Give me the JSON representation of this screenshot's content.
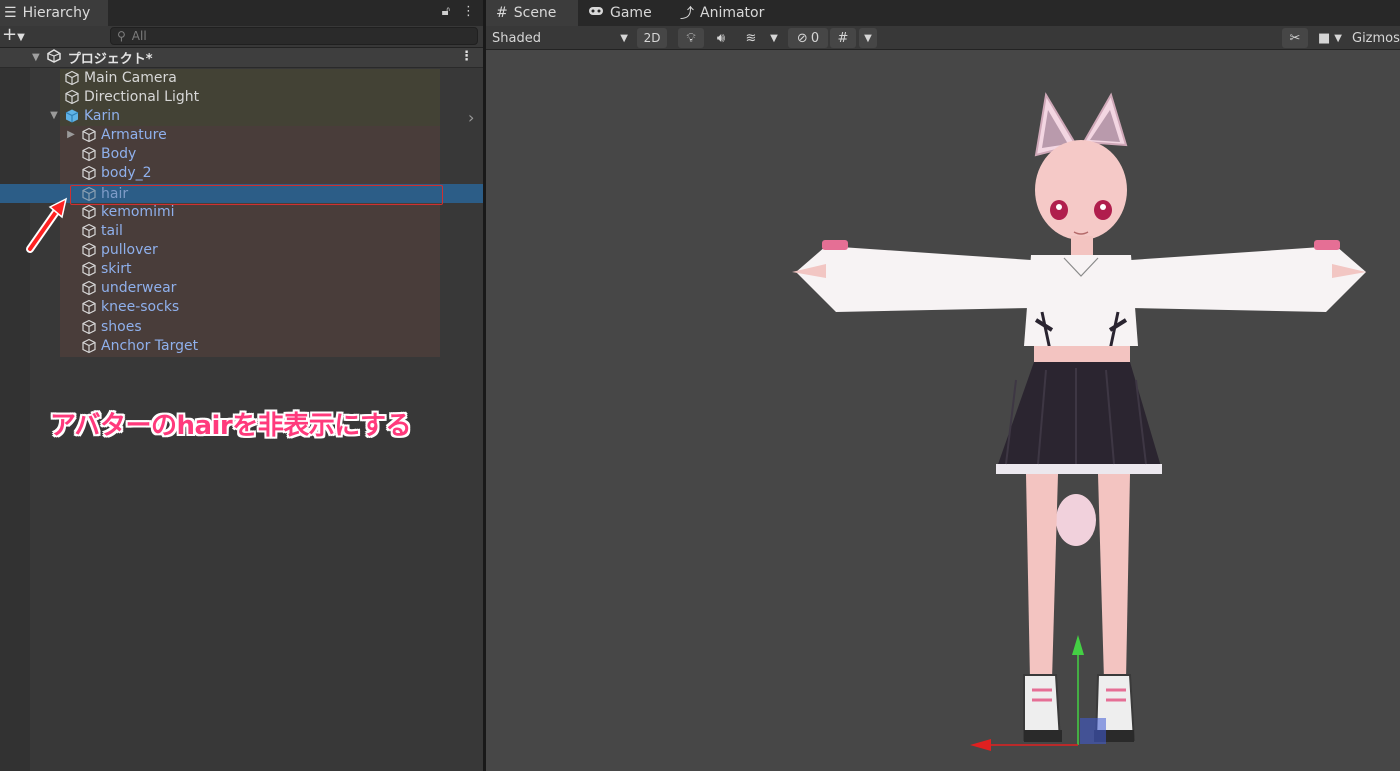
{
  "hierarchy": {
    "tab_label": "Hierarchy",
    "search_placeholder": "All",
    "scene_name": "プロジェクト*",
    "items": [
      {
        "label": "Main Camera"
      },
      {
        "label": "Directional Light"
      },
      {
        "label": "Karin"
      },
      {
        "label": "Armature"
      },
      {
        "label": "Body"
      },
      {
        "label": "body_2"
      },
      {
        "label": "hair"
      },
      {
        "label": "kemomimi"
      },
      {
        "label": "tail"
      },
      {
        "label": "pullover"
      },
      {
        "label": "skirt"
      },
      {
        "label": "underwear"
      },
      {
        "label": "knee-socks"
      },
      {
        "label": "shoes"
      },
      {
        "label": "Anchor Target"
      }
    ],
    "selected_item": "hair"
  },
  "annotation": {
    "text": "アバターのhairを非表示にする",
    "color": "#ff3a7c"
  },
  "scene_panel": {
    "tabs": [
      {
        "label": "Scene",
        "icon": "grid-icon"
      },
      {
        "label": "Game",
        "icon": "gamepad-icon"
      },
      {
        "label": "Animator",
        "icon": "animator-icon"
      }
    ],
    "shading_mode": "Shaded",
    "mode_2d_label": "2D",
    "hidden_count": "0",
    "gizmos_label": "Gizmos"
  },
  "colors": {
    "selection": "#2c5d87",
    "prefab_text": "#8fb0ec",
    "highlight_box": "#d03030"
  }
}
